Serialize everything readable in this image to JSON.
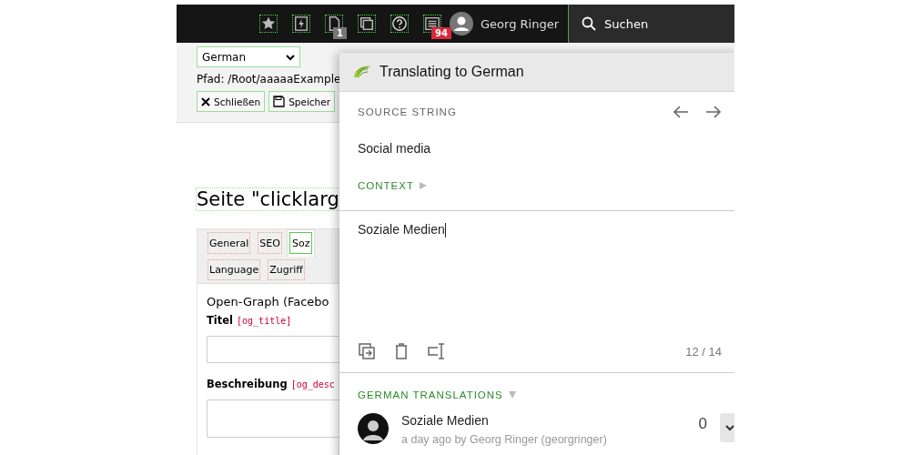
{
  "topbar": {
    "icons": [
      {
        "kind": "star"
      },
      {
        "kind": "bolt"
      },
      {
        "kind": "file",
        "badge": "1",
        "color": "#777777"
      },
      {
        "kind": "windows"
      },
      {
        "kind": "help"
      },
      {
        "kind": "list",
        "badge": "94",
        "color": "#d9283c"
      }
    ],
    "user": "Georg Ringer",
    "search": "Suchen"
  },
  "docheader": {
    "language": "German",
    "path": "Pfad: /Root/aaaaaExample",
    "buttons": [
      {
        "kind": "close",
        "label": "Schließen"
      },
      {
        "kind": "save",
        "label": "Speicher"
      }
    ]
  },
  "page_title": "Seite \"clicklarg",
  "tabs": [
    {
      "label": "General",
      "selected": false
    },
    {
      "label": "SEO",
      "selected": false
    },
    {
      "label": "Soz",
      "selected": true
    }
  ],
  "tabs_row_2": [
    {
      "label": "Language",
      "selected": false
    },
    {
      "label": "Zugriff",
      "selected": false
    }
  ],
  "form": {
    "heading": "Open-Graph (Facebo",
    "fields": [
      {
        "label": "Titel",
        "key": "[og_title]"
      },
      {
        "label": "Beschreibung",
        "key": "[og_desc"
      }
    ]
  },
  "panel": {
    "title": "Translating to German",
    "source_label": "SOURCE STRING",
    "source": "Social media",
    "context_label": "CONTEXT",
    "translation": "Soziale Medien",
    "counter": "12 / 14",
    "translations_label": "GERMAN TRANSLATIONS",
    "translations": [
      {
        "text": "Soziale Medien",
        "meta": "a day ago by Georg Ringer (georgringer)",
        "votes": "0"
      }
    ]
  }
}
